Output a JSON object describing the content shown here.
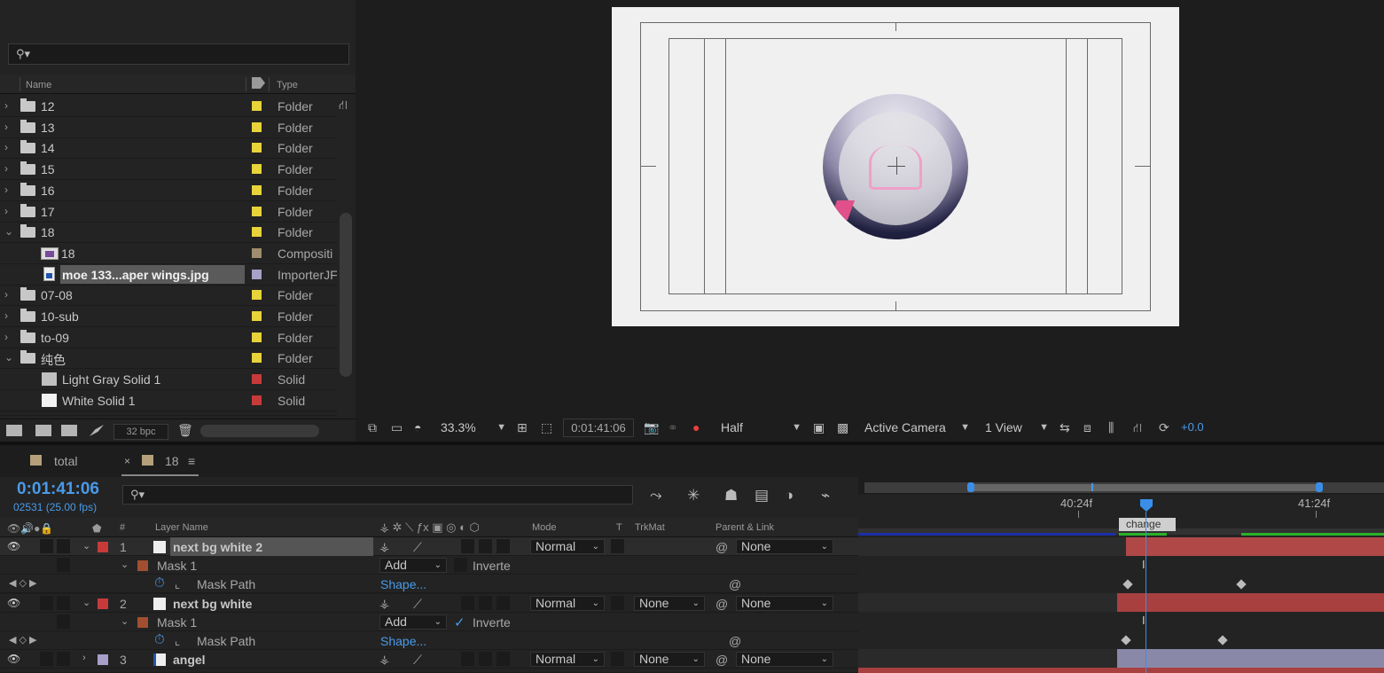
{
  "project": {
    "search_placeholder": "",
    "col_name": "Name",
    "col_type": "Type",
    "items": [
      {
        "name": "12",
        "type": "Folder",
        "kind": "folder",
        "twirl": "›",
        "color": "#e8d33a"
      },
      {
        "name": "13",
        "type": "Folder",
        "kind": "folder",
        "twirl": "›",
        "color": "#e8d33a"
      },
      {
        "name": "14",
        "type": "Folder",
        "kind": "folder",
        "twirl": "›",
        "color": "#e8d33a"
      },
      {
        "name": "15",
        "type": "Folder",
        "kind": "folder",
        "twirl": "›",
        "color": "#e8d33a"
      },
      {
        "name": "16",
        "type": "Folder",
        "kind": "folder",
        "twirl": "›",
        "color": "#e8d33a"
      },
      {
        "name": "17",
        "type": "Folder",
        "kind": "folder",
        "twirl": "›",
        "color": "#e8d33a"
      },
      {
        "name": "18",
        "type": "Folder",
        "kind": "folder",
        "twirl": "⌄",
        "color": "#e8d33a"
      },
      {
        "name": "18",
        "type": "Compositi",
        "kind": "comp",
        "color": "#a08c6e"
      },
      {
        "name": "moe 133...aper wings.jpg",
        "type": "ImporterJF",
        "kind": "jpg",
        "color": "#a8a0c8",
        "selected": true
      },
      {
        "name": "07-08",
        "type": "Folder",
        "kind": "folder",
        "twirl": "›",
        "color": "#e8d33a"
      },
      {
        "name": "10-sub",
        "type": "Folder",
        "kind": "folder",
        "twirl": "›",
        "color": "#e8d33a"
      },
      {
        "name": "to-09",
        "type": "Folder",
        "kind": "folder",
        "twirl": "›",
        "color": "#e8d33a"
      },
      {
        "name": "纯色",
        "type": "Folder",
        "kind": "folder",
        "twirl": "⌄",
        "color": "#e8d33a"
      },
      {
        "name": "Light Gray Solid 1",
        "type": "Solid",
        "kind": "solid-gray",
        "color": "#c83a3a"
      },
      {
        "name": "White Solid 1",
        "type": "Solid",
        "kind": "solid",
        "color": "#c83a3a"
      }
    ],
    "bpc": "32 bpc"
  },
  "viewer": {
    "zoom": "33.3%",
    "timecode": "0:01:41:06",
    "resolution": "Half",
    "camera": "Active Camera",
    "views": "1 View",
    "exposure": "+0.0"
  },
  "tabs": [
    {
      "label": "total",
      "color": "#b5a07a"
    },
    {
      "label": "18",
      "color": "#b5a07a",
      "active": true
    }
  ],
  "tab_close": "×",
  "tab_menu": "≡",
  "timeline": {
    "timecode": "0:01:41:06",
    "frames": "02531 (25.00 fps)",
    "columns": {
      "num": "#",
      "layer_name": "Layer Name",
      "mode": "Mode",
      "t": "T",
      "trkmat": "TrkMat",
      "parent": "Parent & Link"
    },
    "ruler_labels": [
      "40:24f",
      "41:24f"
    ],
    "marker": "change",
    "rows": [
      {
        "type": "layer",
        "num": "1",
        "name": "next bg white 2",
        "color": "#c83a3a",
        "mode": "Normal",
        "trkmat": "",
        "parent": "None",
        "selected": true
      },
      {
        "type": "mask",
        "name": "Mask 1",
        "mode": "Add",
        "inverted_label": "Inverte",
        "inverted": false
      },
      {
        "type": "prop",
        "name": "Mask Path",
        "value": "Shape..."
      },
      {
        "type": "layer",
        "num": "2",
        "name": "next bg white",
        "color": "#c83a3a",
        "mode": "Normal",
        "trkmat": "None",
        "parent": "None"
      },
      {
        "type": "mask",
        "name": "Mask 1",
        "mode": "Add",
        "inverted_label": "Inverte",
        "inverted": true
      },
      {
        "type": "prop",
        "name": "Mask Path",
        "value": "Shape..."
      },
      {
        "type": "layer",
        "num": "3",
        "name": "angel",
        "color": "#a8a0c8",
        "mode": "Normal",
        "trkmat": "None",
        "parent": "None"
      }
    ]
  }
}
